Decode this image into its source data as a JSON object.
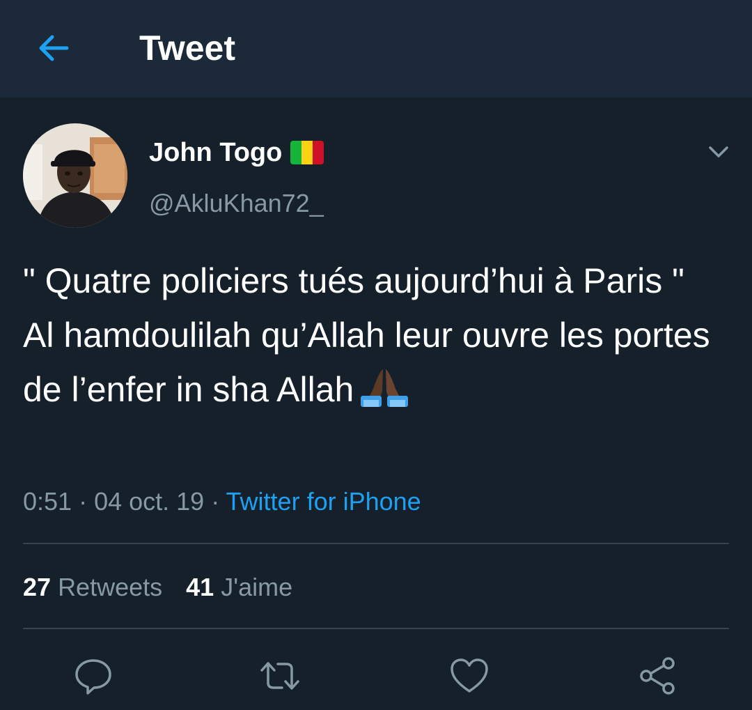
{
  "header": {
    "title": "Tweet"
  },
  "tweet": {
    "display_name": "John Togo",
    "handle": "@AkluKhan72_",
    "text": "\" Quatre policiers tués aujourd’hui à Paris \" Al hamdoulilah qu’Allah leur ouvre les portes de l’enfer in sha Allah",
    "time": "0:51",
    "separator": " · ",
    "date": "04 oct. 19",
    "source": "Twitter for iPhone",
    "retweet_count": "27",
    "retweet_label": "Retweets",
    "like_count": "41",
    "like_label": "J'aime"
  },
  "icons": {
    "back": "arrow-left-icon",
    "caret": "chevron-down-icon",
    "reply": "comment-icon",
    "retweet": "retweet-icon",
    "like": "heart-icon",
    "share": "share-icon",
    "emoji": "folded-hands-emoji",
    "flag": "mali-flag"
  },
  "colors": {
    "background": "#15202b",
    "header": "#1c2938",
    "accent": "#1da1f2",
    "secondary_text": "#8899a6",
    "divider": "#38444d",
    "flag": [
      "#14b53a",
      "#fcd116",
      "#ce1126"
    ]
  }
}
